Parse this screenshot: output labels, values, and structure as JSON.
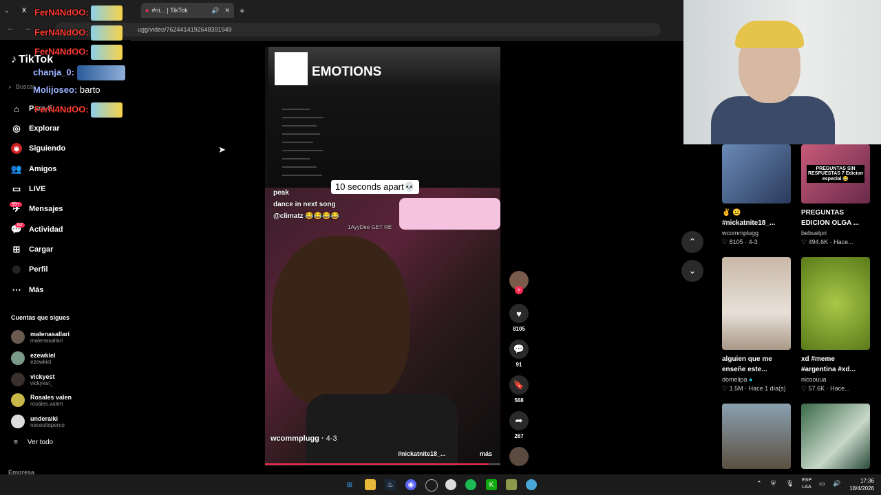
{
  "browser": {
    "tab_active": "#ni... | TikTok",
    "new_tab": "+",
    "url": "ugg/video/7624414192648391949"
  },
  "sidebar": {
    "logo": "TikTok",
    "search_placeholder": "Buscar",
    "nav": [
      {
        "label": "Para ti",
        "icon": "home-icon"
      },
      {
        "label": "Explorar",
        "icon": "compass-icon"
      },
      {
        "label": "Siguiendo",
        "icon": "following-icon"
      },
      {
        "label": "Amigos",
        "icon": "friends-icon"
      },
      {
        "label": "LIVE",
        "icon": "live-icon"
      },
      {
        "label": "Mensajes",
        "icon": "messages-icon",
        "badge": "99+"
      },
      {
        "label": "Actividad",
        "icon": "activity-icon",
        "badge": "62"
      },
      {
        "label": "Cargar",
        "icon": "upload-icon"
      },
      {
        "label": "Perfil",
        "icon": "profile-icon"
      },
      {
        "label": "Más",
        "icon": "more-icon"
      }
    ],
    "following_title": "Cuentas que sigues",
    "accounts": [
      {
        "name": "malenasallari",
        "user": "malenasallari"
      },
      {
        "name": "ezewkiel",
        "user": "ezewkiel"
      },
      {
        "name": "vickyest",
        "user": "vickyest_"
      },
      {
        "name": "Rosales valen",
        "user": "rosales.valen"
      },
      {
        "name": "underaiki",
        "user": "necesitoperco"
      }
    ],
    "see_all": "Ver todo",
    "footer": "Empresa"
  },
  "chat": [
    {
      "user": "FerN4NdOO:",
      "text": "",
      "emote": true
    },
    {
      "user": "FerN4NdOO:",
      "text": "",
      "emote": true
    },
    {
      "user": "FerN4NdOO:",
      "text": "",
      "emote": true
    },
    {
      "user": "chanja_0:",
      "text": "",
      "emote": true
    },
    {
      "user": "Molijoseo:",
      "text": "barto",
      "emote": false
    },
    {
      "user": "FerN4NdOO:",
      "text": "",
      "emote": true
    }
  ],
  "video": {
    "album_title": "EMOTIONS",
    "caption": "10 seconds apart💀",
    "overlay_lines": [
      "peak",
      "dance in next song",
      "@climatz 😂😂😂😂"
    ],
    "stream_tag": "1AyyDee  GET RE",
    "author": "wcommplugg",
    "date": "4-3",
    "hashtag": "#nickatnite18_...",
    "more": "más",
    "progress": 0.95
  },
  "actions": {
    "likes": "8105",
    "comments": "91",
    "saves": "568",
    "shares": "267"
  },
  "recommended": [
    {
      "title": "#nickatnite18_...",
      "prefix": "✌️ 😐",
      "user": "wcommplugg",
      "meta": "8105 · 4-3"
    },
    {
      "title": "PREGUNTAS EDICION OLGA ...",
      "prefix": "",
      "user": "bebuelpri",
      "meta": "494.6K · Hace...",
      "thumb_text": "PREGUNTAS SIN RESPUESTAS 7 Edicion especial 😂"
    },
    {
      "title": "alguien que me enseñe este...",
      "prefix": "",
      "user": "domelipa",
      "meta": "1.5M · Hace 1 día(s)"
    },
    {
      "title": "xd #meme #argentina #xd...",
      "prefix": "",
      "user": "nicoouua",
      "meta": "57.6K · Hace..."
    }
  ],
  "taskbar": {
    "lang": "ESP",
    "lang2": "LAA",
    "time": "17:36",
    "date": "18/4/2026"
  },
  "colors": {
    "accent": "#fe2c55",
    "chat_user": "#ff3b30",
    "chat_user2": "#9bb3ff"
  }
}
